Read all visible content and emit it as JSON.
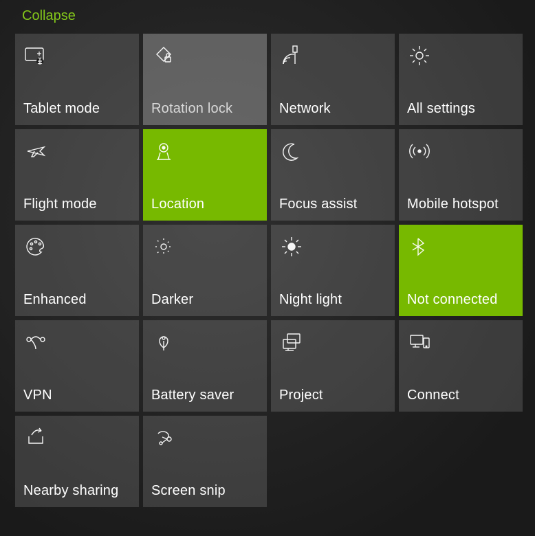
{
  "collapse_label": "Collapse",
  "accent_color": "#77b900",
  "tiles": [
    {
      "id": "tablet-mode",
      "label": "Tablet mode",
      "icon": "tablet-icon",
      "state": "off"
    },
    {
      "id": "rotation-lock",
      "label": "Rotation lock",
      "icon": "rotation-lock-icon",
      "state": "hover"
    },
    {
      "id": "network",
      "label": "Network",
      "icon": "network-icon",
      "state": "off"
    },
    {
      "id": "all-settings",
      "label": "All settings",
      "icon": "settings-icon",
      "state": "off"
    },
    {
      "id": "flight-mode",
      "label": "Flight mode",
      "icon": "airplane-icon",
      "state": "off"
    },
    {
      "id": "location",
      "label": "Location",
      "icon": "location-icon",
      "state": "on"
    },
    {
      "id": "focus-assist",
      "label": "Focus assist",
      "icon": "moon-icon",
      "state": "off"
    },
    {
      "id": "mobile-hotspot",
      "label": "Mobile hotspot",
      "icon": "hotspot-icon",
      "state": "off"
    },
    {
      "id": "enhanced",
      "label": "Enhanced",
      "icon": "palette-icon",
      "state": "off"
    },
    {
      "id": "darker",
      "label": "Darker",
      "icon": "brightness-low-icon",
      "state": "off"
    },
    {
      "id": "night-light",
      "label": "Night light",
      "icon": "brightness-high-icon",
      "state": "off"
    },
    {
      "id": "bluetooth",
      "label": "Not connected",
      "icon": "bluetooth-icon",
      "state": "on"
    },
    {
      "id": "vpn",
      "label": "VPN",
      "icon": "vpn-icon",
      "state": "off"
    },
    {
      "id": "battery-saver",
      "label": "Battery saver",
      "icon": "battery-saver-icon",
      "state": "off"
    },
    {
      "id": "project",
      "label": "Project",
      "icon": "project-icon",
      "state": "off"
    },
    {
      "id": "connect",
      "label": "Connect",
      "icon": "connect-icon",
      "state": "off"
    },
    {
      "id": "nearby-sharing",
      "label": "Nearby sharing",
      "icon": "share-icon",
      "state": "off"
    },
    {
      "id": "screen-snip",
      "label": "Screen snip",
      "icon": "snip-icon",
      "state": "off"
    }
  ]
}
